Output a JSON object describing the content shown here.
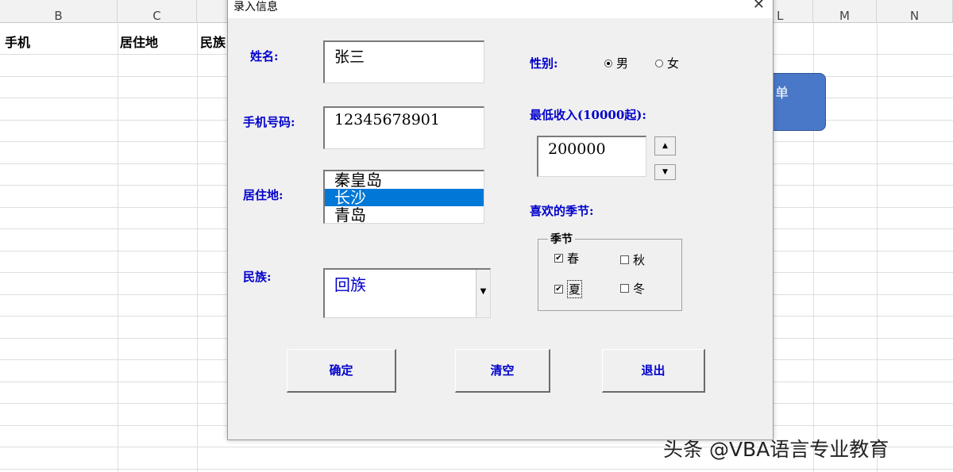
{
  "sheet": {
    "columns": [
      "B",
      "C",
      "L",
      "M",
      "N"
    ],
    "cells": [
      "手机",
      "居住地",
      "民族"
    ],
    "shape_label": "单"
  },
  "watermark": "头条 @VBA语言专业教育",
  "dialog": {
    "title": "录入信息",
    "close_glyph": "✕",
    "name_label": "姓名:",
    "name_value": "张三",
    "phone_label": "手机号码:",
    "phone_value": "12345678901",
    "residence_label": "居住地:",
    "residence_items": [
      "秦皇岛",
      "长沙",
      "青岛"
    ],
    "ethnicity_label": "民族:",
    "ethnicity_value": "回族",
    "gender_label": "性别:",
    "gender_options": [
      "男",
      "女"
    ],
    "income_label": "最低收入(10000起):",
    "income_value": "200000",
    "season_label": "喜欢的季节:",
    "season_frame_title": "季节",
    "seasons": [
      "春",
      "秋",
      "夏",
      "冬"
    ],
    "buttons": [
      "确定",
      "清空",
      "退出"
    ],
    "accent_color": "#0000cc",
    "selection_color": "#0078d7"
  }
}
